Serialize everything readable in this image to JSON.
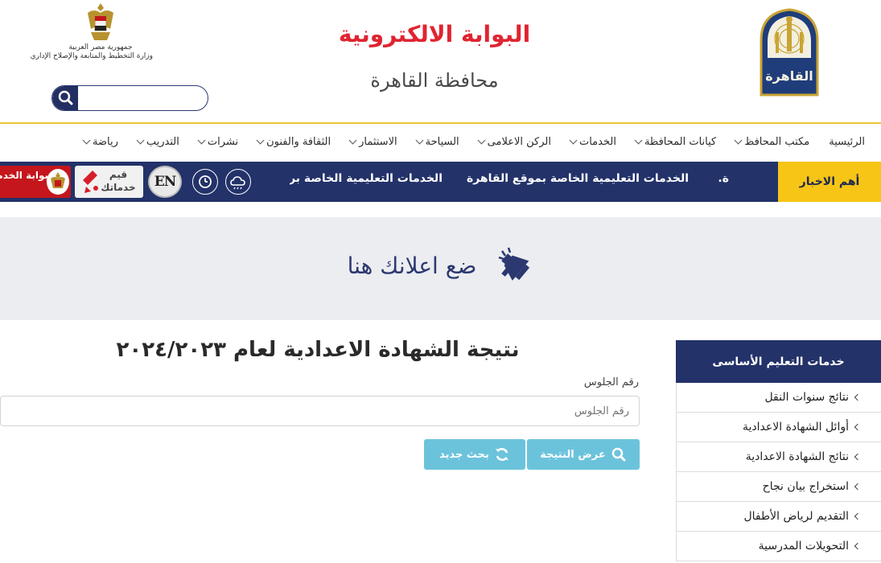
{
  "header": {
    "title": "البوابة الالكترونية",
    "subtitle": "محافظة القاهرة",
    "logo_text": "القاهرة",
    "ministry_line1": "جمهورية مصر العربية",
    "ministry_line2": "وزارة التخطيط والمتابعة والإصلاح الإداري",
    "search_placeholder": "",
    "search_value": ""
  },
  "nav": {
    "items": [
      {
        "label": "الرئيسية",
        "dropdown": false
      },
      {
        "label": "مكتب المحافظ",
        "dropdown": true
      },
      {
        "label": "كيانات المحافظة",
        "dropdown": true
      },
      {
        "label": "الخدمات",
        "dropdown": true
      },
      {
        "label": "الركن الاعلامى",
        "dropdown": true
      },
      {
        "label": "السياحة",
        "dropdown": true
      },
      {
        "label": "الاستثمار",
        "dropdown": true
      },
      {
        "label": "الثقافة والفنون",
        "dropdown": true
      },
      {
        "label": "نشرات",
        "dropdown": true
      },
      {
        "label": "التدريب",
        "dropdown": true
      },
      {
        "label": "رياضة",
        "dropdown": true
      }
    ]
  },
  "newsbar": {
    "label": "أهم الاخبار",
    "ticker": [
      "ة.",
      "الخدمات التعليمية الخاصة بموقع القاهرة",
      "الخدمات التعليمية الخاصة بر"
    ],
    "en_label": "EN",
    "qayim_label": "قيم خدماتك",
    "egov_label": "بوابة الخدمات الإلكترونية"
  },
  "ad": {
    "text": "ضع اعلانك هنا"
  },
  "sidebar": {
    "title": "خدمات التعليم الأساسى",
    "items": [
      "نتائج سنوات النقل",
      "أوائل الشهادة الاعدادية",
      "نتائج الشهادة الاعدادية",
      "استخراج بيان نجاح",
      "التقديم لرياض الأطفال",
      "التحويلات المدرسية"
    ]
  },
  "main": {
    "title": "نتيجة الشهادة الاعدادية لعام ٢٠٢٤/٢٠٢٣",
    "seat_label": "رقم الجلوس",
    "seat_placeholder": "رقم الجلوس",
    "seat_value": "",
    "show_button": "عرض النتيجة",
    "new_button": "بحث جديد"
  },
  "colors": {
    "navy": "#233269",
    "gold": "#f6c515",
    "red": "#e02430",
    "button": "#6bc3db"
  }
}
